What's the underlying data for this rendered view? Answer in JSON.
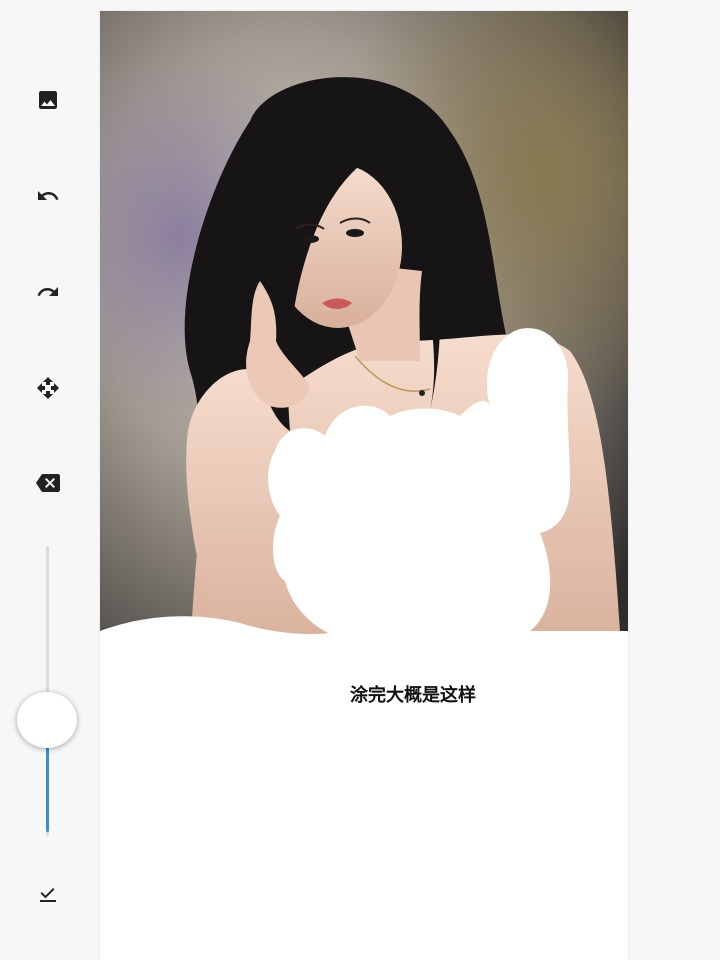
{
  "toolbar": {
    "tools": [
      {
        "name": "image-icon",
        "label": "image"
      },
      {
        "name": "undo-icon",
        "label": "undo"
      },
      {
        "name": "redo-icon",
        "label": "redo"
      },
      {
        "name": "move-icon",
        "label": "move"
      },
      {
        "name": "clear-icon",
        "label": "clear"
      },
      {
        "name": "done-icon",
        "label": "done"
      }
    ],
    "brush_size": {
      "value": 0.4,
      "accent": "#3a8fd0"
    }
  },
  "canvas": {
    "image": "photo-woman-portrait",
    "paint_color": "#ffffff",
    "caption": "涂完大概是这样"
  }
}
